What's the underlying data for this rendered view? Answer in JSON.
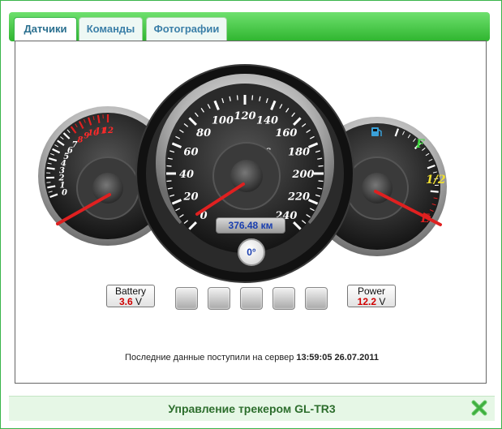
{
  "tabs": [
    {
      "label": "Датчики",
      "active": true
    },
    {
      "label": "Команды",
      "active": false
    },
    {
      "label": "Фотографии",
      "active": false
    }
  ],
  "left_gauge": {
    "ticks": [
      "0",
      "1",
      "2",
      "3",
      "4",
      "5",
      "6",
      "7",
      "8",
      "9",
      "10",
      "11",
      "12"
    ],
    "red_from": 8
  },
  "speedometer": {
    "unit": "км/час",
    "ticks": [
      "0",
      "20",
      "40",
      "60",
      "80",
      "100",
      "120",
      "140",
      "160",
      "180",
      "200",
      "220",
      "240"
    ],
    "odometer": "376.48 км",
    "heading": "0°"
  },
  "fuel_gauge": {
    "labels": {
      "full": "F",
      "half": "1/2",
      "empty": "E"
    }
  },
  "battery": {
    "label": "Battery",
    "value": "3.6",
    "unit": "V"
  },
  "power": {
    "label": "Power",
    "value": "12.2",
    "unit": "V"
  },
  "indicators_count": 5,
  "status": {
    "text": "Последние данные поступили на сервер",
    "time": "13:59:05 26.07.2011"
  },
  "footer": {
    "title": "Управление трекером GL-TR3"
  },
  "colors": {
    "accent": "#39b54a",
    "tab_text": "#2a6f8f",
    "needle": "#e02020",
    "speed_text": "#ffffff",
    "value_red": "#d00000"
  }
}
